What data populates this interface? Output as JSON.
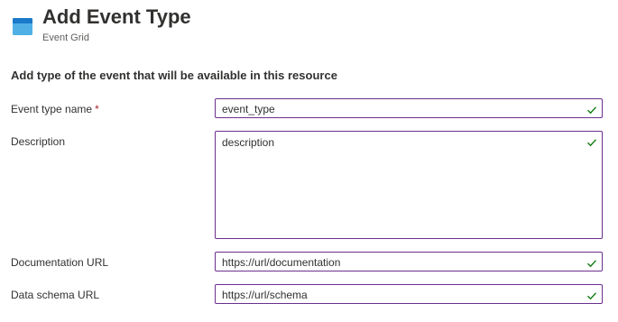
{
  "header": {
    "icon": "event-grid-icon",
    "title": "Add Event Type",
    "subtitle": "Event Grid"
  },
  "form": {
    "heading": "Add type of the event that will be available in this resource",
    "required_marker": "*",
    "valid_icon": "checkmark-icon",
    "accent_color": "#6b2f8e",
    "valid_color": "#107c10",
    "fields": {
      "event_type_name": {
        "label": "Event type name",
        "value": "event_type",
        "required": true
      },
      "description": {
        "label": "Description",
        "value": "description"
      },
      "documentation_url": {
        "label": "Documentation URL",
        "value": "https://url/documentation"
      },
      "data_schema_url": {
        "label": "Data schema URL",
        "value": "https://url/schema"
      }
    }
  }
}
